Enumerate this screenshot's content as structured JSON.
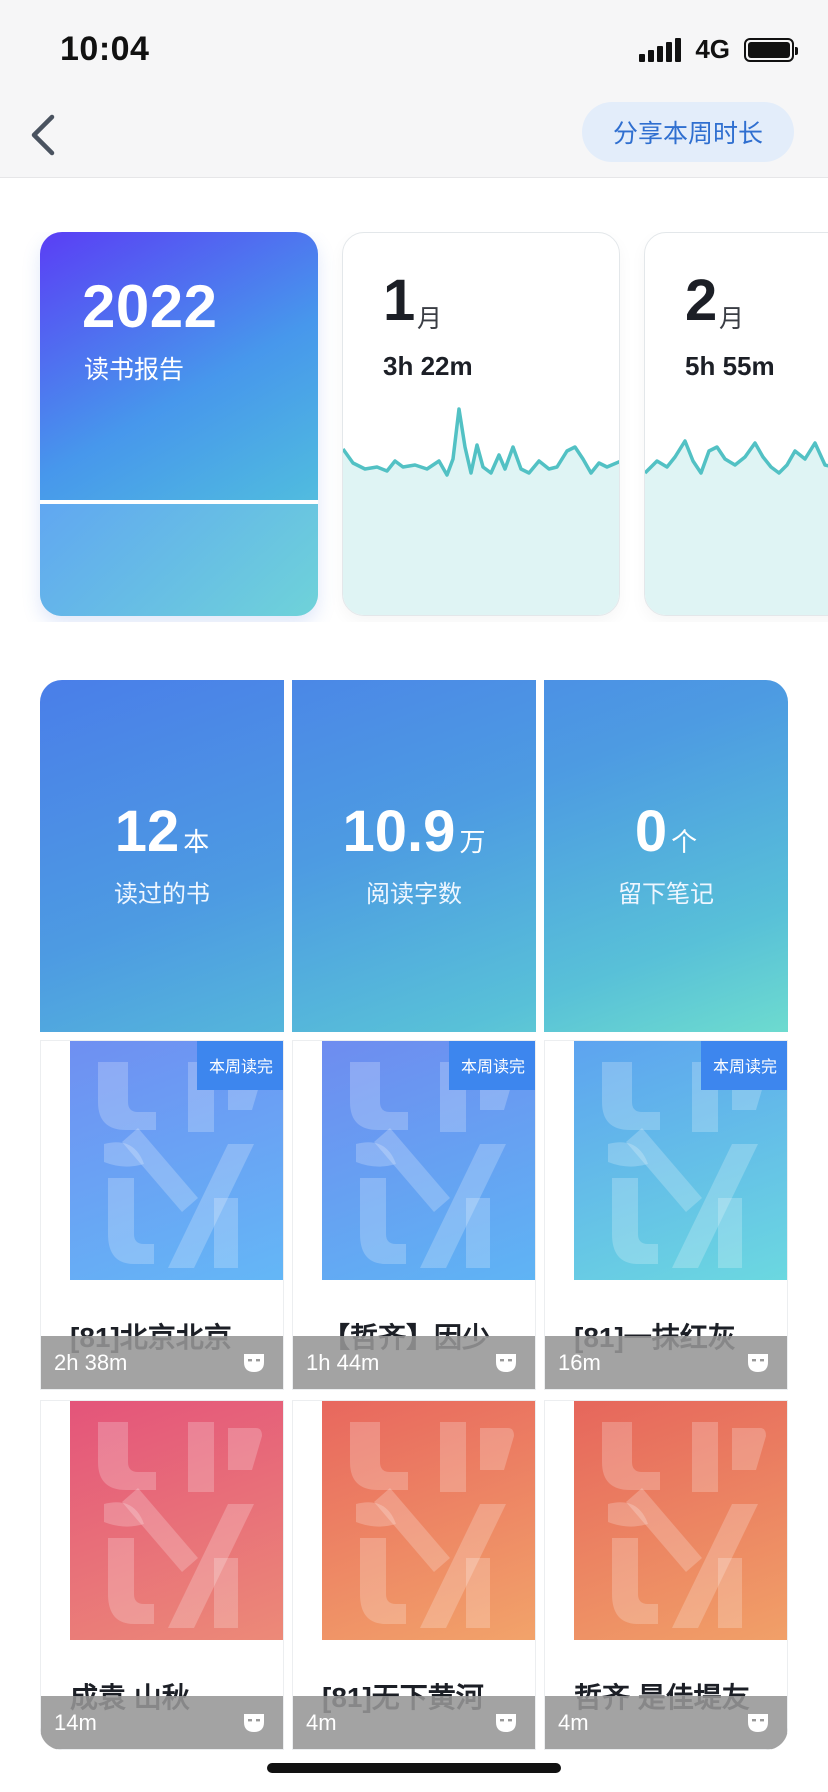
{
  "status_bar": {
    "time": "10:04",
    "network": "4G"
  },
  "nav": {
    "share_label": "分享本周时长"
  },
  "year_card": {
    "year": "2022",
    "subtitle": "读书报告"
  },
  "month_cards": [
    {
      "month": "1",
      "unit": "月",
      "duration": "3h 22m"
    },
    {
      "month": "2",
      "unit": "月",
      "duration": "5h 55m"
    }
  ],
  "stats": [
    {
      "value": "12",
      "unit": "本",
      "label": "读过的书"
    },
    {
      "value": "10.9",
      "unit": "万",
      "label": "阅读字数"
    },
    {
      "value": "0",
      "unit": "个",
      "label": "留下笔记"
    }
  ],
  "books": [
    {
      "title": "[81]北京北京",
      "duration": "2h 38m",
      "badge": "本周读完",
      "colors": [
        "#6f8ff2",
        "#64b7f6"
      ]
    },
    {
      "title": "【哲齐】因少",
      "duration": "1h 44m",
      "badge": "本周读完",
      "colors": [
        "#6e8cf0",
        "#5fb4f4"
      ]
    },
    {
      "title": "[81]一抹红灰",
      "duration": "16m",
      "badge": "本周读完",
      "colors": [
        "#5da3f0",
        "#6bd8e0"
      ]
    },
    {
      "title": "成袁 山秋",
      "duration": "14m",
      "badge": "",
      "colors": [
        "#e4547a",
        "#ec8a78"
      ]
    },
    {
      "title": "[81]无下黄河",
      "duration": "4m",
      "badge": "",
      "colors": [
        "#e8675e",
        "#f2a36a"
      ]
    },
    {
      "title": "哲齐 是佳堤友",
      "duration": "4m",
      "badge": "",
      "colors": [
        "#e6665c",
        "#f1a068"
      ]
    }
  ],
  "icons": {
    "back": "chevron-left-icon",
    "duration_mask": "mask-icon",
    "signal": "signal-icon",
    "battery": "battery-icon"
  },
  "accent": "#2f6fd0"
}
